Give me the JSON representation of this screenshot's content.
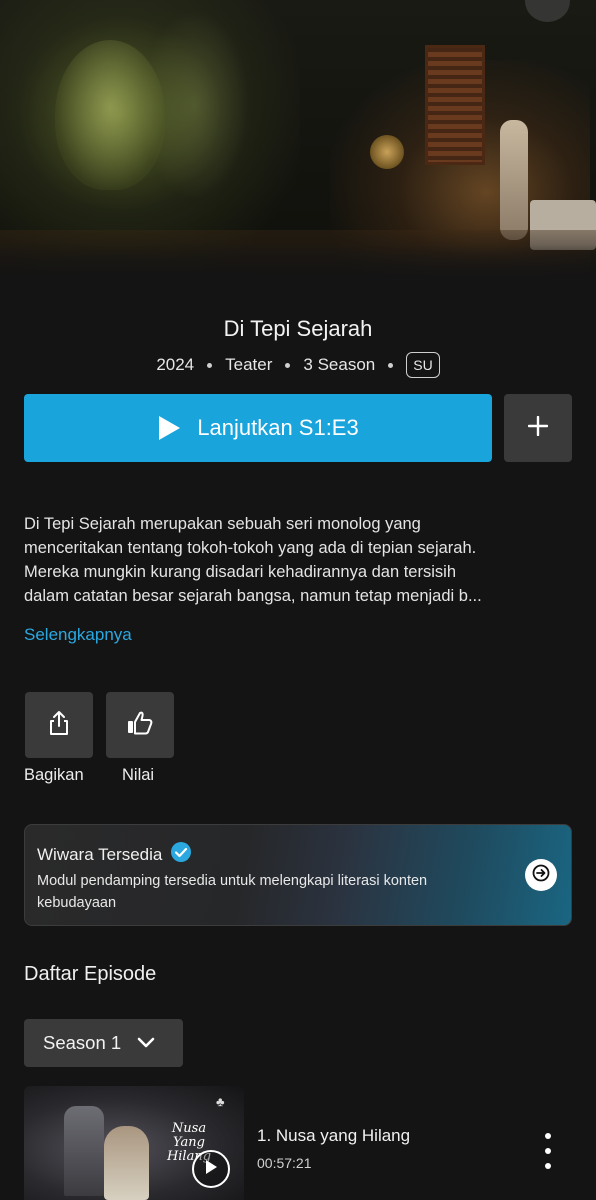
{
  "show": {
    "title": "Di Tepi Sejarah",
    "year": "2024",
    "genre": "Teater",
    "seasons": "3 Season",
    "rating": "SU"
  },
  "actions": {
    "play_label": "Lanjutkan S1:E3",
    "share_label": "Bagikan",
    "rate_label": "Nilai"
  },
  "description": {
    "lines": [
      "Di Tepi Sejarah merupakan sebuah seri monolog yang",
      "menceritakan tentang tokoh-tokoh yang ada di tepian sejarah.",
      "Mereka mungkin kurang disadari kehadirannya dan tersisih",
      "dalam catatan besar sejarah bangsa, namun tetap menjadi b..."
    ],
    "more_link": "Selengkapnya"
  },
  "wiwara": {
    "title": "Wiwara Tersedia",
    "text": "Modul pendamping tersedia untuk melengkapi literasi konten kebudayaan"
  },
  "episodes": {
    "header": "Daftar Episode",
    "season_selected": "Season 1",
    "items": [
      {
        "title": "1. Nusa yang Hilang",
        "duration": "00:57:21",
        "thumb_title_lines": [
          "Nusa",
          "Yang",
          "Hilang"
        ]
      }
    ]
  },
  "colors": {
    "accent": "#1aa4dc",
    "link": "#2ba8e0",
    "background": "#141414",
    "button_dark": "#3a3a3a"
  },
  "icons": {
    "play": "play-icon",
    "add": "plus-icon",
    "share": "share-icon",
    "rate": "thumbs-up-icon",
    "verified": "check-circle-icon",
    "arrow": "arrow-right-icon",
    "dropdown": "chevron-down-icon",
    "more": "more-vertical-icon"
  }
}
